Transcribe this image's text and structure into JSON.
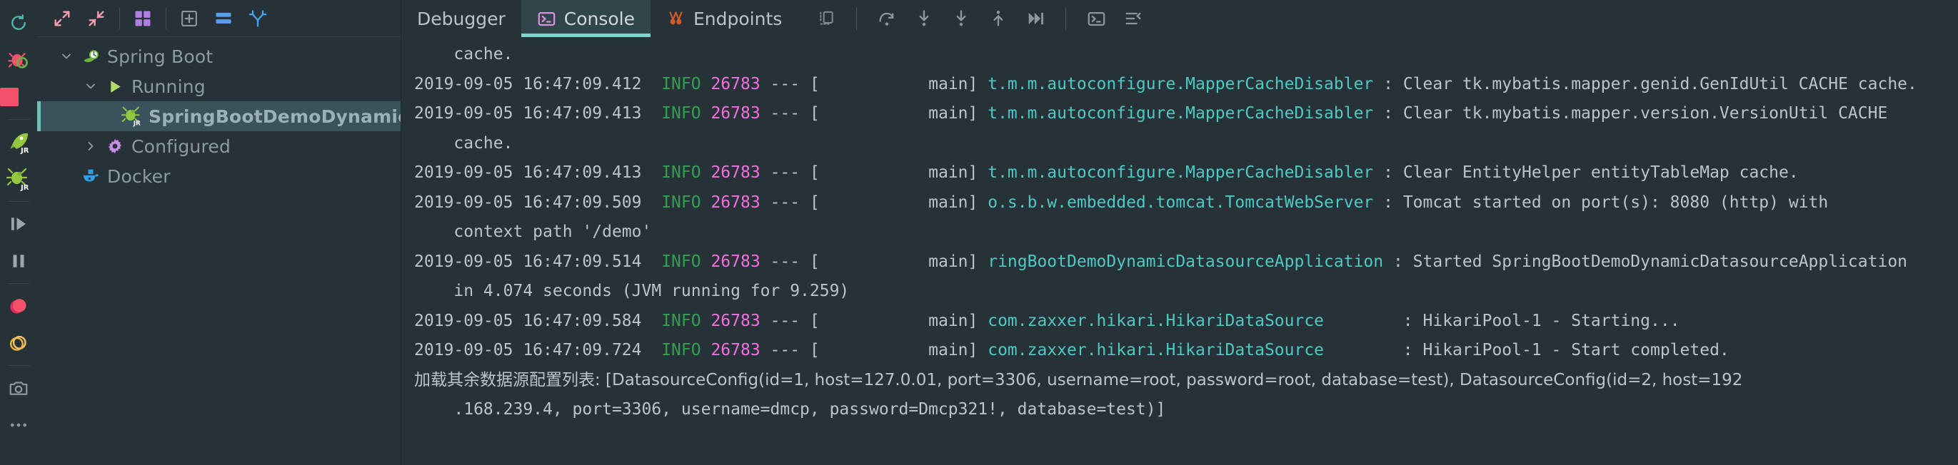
{
  "rail": {
    "buttons": [
      {
        "name": "rerun-icon",
        "label": "Rerun"
      },
      {
        "name": "debug-bug-icon",
        "label": "Debug"
      },
      {
        "name": "stop-icon",
        "label": "Stop"
      },
      {
        "name": "rocket-jr-icon",
        "label": "Run Dashboard Rocket"
      },
      {
        "name": "bug-jr-icon",
        "label": "Debug Bug JR"
      },
      {
        "name": "step-over-icon",
        "label": "Resume Program"
      },
      {
        "name": "pause-icon",
        "label": "Pause Program"
      },
      {
        "name": "breakpoint-icon",
        "label": "View Breakpoints"
      },
      {
        "name": "mute-breakpoints-icon",
        "label": "Mute Breakpoints"
      },
      {
        "name": "camera-icon",
        "label": "Screenshot"
      },
      {
        "name": "more-icon",
        "label": "More"
      }
    ]
  },
  "tree_toolbar": {
    "buttons": [
      {
        "name": "expand-all-icon",
        "label": "Expand All"
      },
      {
        "name": "collapse-all-icon",
        "label": "Collapse All"
      },
      {
        "name": "group-icon",
        "label": "Group"
      },
      {
        "name": "add-configuration-icon",
        "label": "Add Configuration"
      },
      {
        "name": "layout-icon",
        "label": "Layout"
      },
      {
        "name": "branch-icon",
        "label": "Branch"
      }
    ]
  },
  "tree": {
    "nodes": [
      {
        "label": "Spring Boot",
        "icon": "spring-leaf-icon",
        "indent": 0,
        "twisty": "down",
        "selected": false
      },
      {
        "label": "Running",
        "icon": "run-play-icon",
        "indent": 1,
        "twisty": "down",
        "selected": false
      },
      {
        "label": "SpringBootDemoDynamicDa",
        "icon": "bug-jr-icon",
        "indent": 2,
        "twisty": "none",
        "selected": true
      },
      {
        "label": "Configured",
        "icon": "gear-icon",
        "indent": 1,
        "twisty": "right",
        "selected": false
      },
      {
        "label": "Docker",
        "icon": "docker-whale-icon",
        "indent": 0,
        "twisty": "none",
        "selected": false
      }
    ]
  },
  "tabs": [
    {
      "label": "Debugger",
      "icon": "none",
      "active": false
    },
    {
      "label": "Console",
      "icon": "console-terminal-icon",
      "active": true
    },
    {
      "label": "Endpoints",
      "icon": "endpoints-icon",
      "active": false
    }
  ],
  "tab_extra": {
    "buttons": [
      {
        "name": "layout-settings-icon",
        "label": "Layout Settings"
      },
      {
        "name": "step-over-icon",
        "label": "Step Over"
      },
      {
        "name": "step-into-icon",
        "label": "Step Into"
      },
      {
        "name": "force-step-into-icon",
        "label": "Force Step Into"
      },
      {
        "name": "step-out-icon",
        "label": "Step Out"
      },
      {
        "name": "run-to-cursor-icon",
        "label": "Run To Cursor"
      },
      {
        "name": "evaluate-expression-icon",
        "label": "Evaluate Expression"
      },
      {
        "name": "settings-lines-icon",
        "label": "Settings"
      }
    ]
  },
  "colors": {
    "background": "#263238",
    "accent_teal": "#7fd6cc",
    "selection": "#38535b",
    "info_green": "#30a14e",
    "pid_magenta": "#f36fde",
    "logger_cyan": "#4ec9c3",
    "text": "#b9c5ca"
  },
  "console": {
    "lines": [
      {
        "type": "cont",
        "text": "    cache."
      },
      {
        "type": "log",
        "date": "2019-09-05 16:47:09.412",
        "level": "INFO",
        "pid": "26783",
        "dash": "---",
        "thread": "[           main]",
        "logger": "t.m.m.autoconfigure.MapperCacheDisabler",
        "sep": " : ",
        "message": "Clear tk.mybatis.mapper.genid.GenIdUtil CACHE cache."
      },
      {
        "type": "log",
        "date": "2019-09-05 16:47:09.413",
        "level": "INFO",
        "pid": "26783",
        "dash": "---",
        "thread": "[           main]",
        "logger": "t.m.m.autoconfigure.MapperCacheDisabler",
        "sep": " : ",
        "message": "Clear tk.mybatis.mapper.version.VersionUtil CACHE"
      },
      {
        "type": "cont",
        "text": "    cache."
      },
      {
        "type": "log",
        "date": "2019-09-05 16:47:09.413",
        "level": "INFO",
        "pid": "26783",
        "dash": "---",
        "thread": "[           main]",
        "logger": "t.m.m.autoconfigure.MapperCacheDisabler",
        "sep": " : ",
        "message": "Clear EntityHelper entityTableMap cache."
      },
      {
        "type": "log",
        "date": "2019-09-05 16:47:09.509",
        "level": "INFO",
        "pid": "26783",
        "dash": "---",
        "thread": "[           main]",
        "logger": "o.s.b.w.embedded.tomcat.TomcatWebServer",
        "sep": " : ",
        "message": "Tomcat started on port(s): 8080 (http) with"
      },
      {
        "type": "cont",
        "text": "    context path '/demo'"
      },
      {
        "type": "log",
        "date": "2019-09-05 16:47:09.514",
        "level": "INFO",
        "pid": "26783",
        "dash": "---",
        "thread": "[           main]",
        "logger": "ringBootDemoDynamicDatasourceApplication",
        "sep": " : ",
        "message": "Started SpringBootDemoDynamicDatasourceApplication"
      },
      {
        "type": "cont",
        "text": "    in 4.074 seconds (JVM running for 9.259)"
      },
      {
        "type": "log",
        "date": "2019-09-05 16:47:09.584",
        "level": "INFO",
        "pid": "26783",
        "dash": "---",
        "thread": "[           main]",
        "logger": "com.zaxxer.hikari.HikariDataSource",
        "sep": "        : ",
        "message": "HikariPool-1 - Starting..."
      },
      {
        "type": "log",
        "date": "2019-09-05 16:47:09.724",
        "level": "INFO",
        "pid": "26783",
        "dash": "---",
        "thread": "[           main]",
        "logger": "com.zaxxer.hikari.HikariDataSource",
        "sep": "        : ",
        "message": "HikariPool-1 - Start completed."
      },
      {
        "type": "plain",
        "text": "加载其余数据源配置列表: [DatasourceConfig(id=1, host=127.0.01, port=3306, username=root, password=root, database=test), DatasourceConfig(id=2, host=192"
      },
      {
        "type": "cont",
        "text": "    .168.239.4, port=3306, username=dmcp, password=Dmcp321!, database=test)]"
      }
    ]
  }
}
